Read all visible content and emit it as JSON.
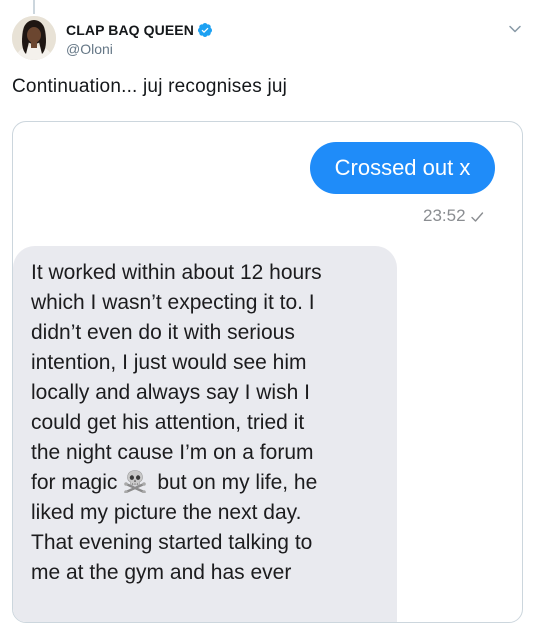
{
  "tweet": {
    "display_name": "CLAP BAQ QUEEN",
    "handle": "@Oloni",
    "verified": true,
    "text": "Continuation... juj recognises juj",
    "icons": {
      "verified": "verified-badge-icon",
      "menu": "chevron-down-icon",
      "avatar": "avatar"
    },
    "colors": {
      "verified": "#1da1f2",
      "handle": "#657786"
    }
  },
  "screenshot": {
    "outgoing_message": "Crossed out x",
    "timestamp": "23:52",
    "read_icon": "checkmark-icon",
    "incoming_message_lines": [
      "It worked within about 12 hours",
      "which I wasn’t expecting it to. I",
      "didn’t even do it with serious",
      "intention, I just would see him",
      "locally and always say I wish I",
      "could get his attention, tried it",
      "the night cause I’m on a forum",
      "for magic",
      "but on my life, he",
      "liked my picture the next day.",
      "That evening started talking to",
      "me at the gym and has ever"
    ],
    "emoji": "skull-and-crossbones-icon",
    "colors": {
      "outgoing_bubble": "#1f8cf9",
      "incoming_bubble": "#e9eaef"
    }
  }
}
